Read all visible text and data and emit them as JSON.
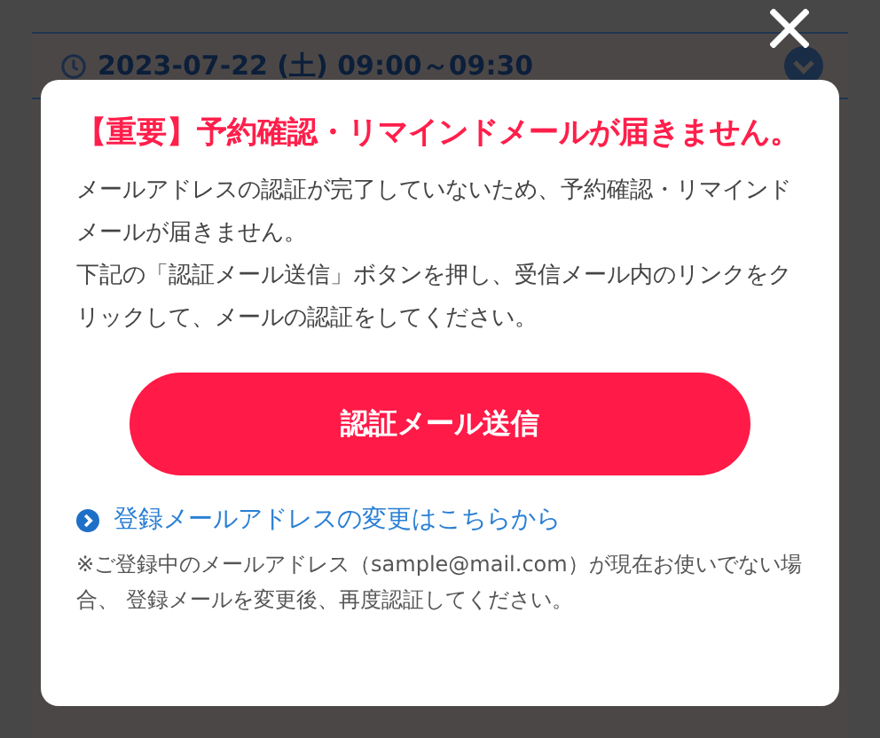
{
  "background": {
    "reservation": {
      "datetime": "2023-07-22 (土) 09:00～09:30"
    }
  },
  "modal": {
    "title": "【重要】予約確認・リマインドメールが届きません。",
    "paragraphs": [
      "メールアドレスの認証が完了していないため、予約確認・リマインドメールが届きません。",
      "下記の「認証メール送信」ボタンを押し、受信メール内のリンクをクリックして、メールの認証をしてください。"
    ],
    "button": "認証メール送信",
    "link": "登録メールアドレスの変更はこちらから",
    "note": "※ご登録中のメールアドレス（sample@mail.com）が現在お使いでない場合、 登録メールを変更後、再度認証してください。"
  }
}
